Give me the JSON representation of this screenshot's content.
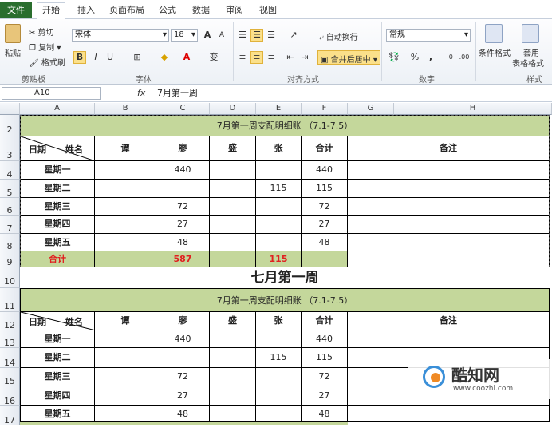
{
  "ribbon_tabs": {
    "file": "文件",
    "home": "开始",
    "insert": "插入",
    "layout": "页面布局",
    "formula": "公式",
    "data": "数据",
    "review": "审阅",
    "view": "视图"
  },
  "clipboard": {
    "paste": "粘贴",
    "cut": "剪切",
    "copy": "复制",
    "format_painter": "格式刷",
    "label": "剪贴板"
  },
  "font": {
    "name": "宋体",
    "size": "18",
    "label": "字体",
    "bold": "B",
    "italic": "I",
    "underline": "U",
    "grow": "A",
    "shrink": "A",
    "wen": "变"
  },
  "alignment": {
    "wrap": "自动换行",
    "merge": "合并后居中",
    "label": "对齐方式"
  },
  "number": {
    "format": "常规",
    "percent": "%",
    "comma": ",",
    "inc": ".0",
    "dec": ".00",
    "label": "数字"
  },
  "styles": {
    "conditional": "条件格式",
    "table1": "套用",
    "table2": "表格格式",
    "label": "样式"
  },
  "formula_bar": {
    "name_box": "A10",
    "fx": "fx",
    "content": "7月第一周"
  },
  "columns": [
    "A",
    "B",
    "C",
    "D",
    "E",
    "F",
    "G",
    "H"
  ],
  "rows": [
    "2",
    "3",
    "4",
    "5",
    "6",
    "7",
    "8",
    "9",
    "10",
    "11",
    "12",
    "13",
    "14",
    "15",
    "16",
    "17"
  ],
  "table1": {
    "title": "7月第一周支配明细账 （7.1-7.5）",
    "header": {
      "date": "日期",
      "name": "姓名",
      "tan": "谭",
      "liao": "廖",
      "sheng": "盛",
      "zhang": "张",
      "total": "合计",
      "note": "备注"
    },
    "body": [
      {
        "day": "星期一",
        "tan": "",
        "liao": "440",
        "sheng": "",
        "zhang": "",
        "total": "440"
      },
      {
        "day": "星期二",
        "tan": "",
        "liao": "",
        "sheng": "",
        "zhang": "115",
        "total": "115"
      },
      {
        "day": "星期三",
        "tan": "",
        "liao": "72",
        "sheng": "",
        "zhang": "",
        "total": "72"
      },
      {
        "day": "星期四",
        "tan": "",
        "liao": "27",
        "sheng": "",
        "zhang": "",
        "total": "27"
      },
      {
        "day": "星期五",
        "tan": "",
        "liao": "48",
        "sheng": "",
        "zhang": "",
        "total": "48"
      }
    ],
    "sum": {
      "label": "合计",
      "liao": "587",
      "zhang": "115"
    }
  },
  "heading10": "七月第一周",
  "table2": {
    "title": "7月第一周支配明细账 （7.1-7.5）",
    "header": {
      "date": "日期",
      "name": "姓名",
      "tan": "谭",
      "liao": "廖",
      "sheng": "盛",
      "zhang": "张",
      "total": "合计",
      "note": "备注"
    },
    "body": [
      {
        "day": "星期一",
        "liao": "440",
        "zhang": "",
        "total": "440"
      },
      {
        "day": "星期二",
        "liao": "",
        "zhang": "115",
        "total": "115"
      },
      {
        "day": "星期三",
        "liao": "72",
        "zhang": "",
        "total": "72"
      },
      {
        "day": "星期四",
        "liao": "27",
        "zhang": "",
        "total": "27"
      },
      {
        "day": "星期五",
        "liao": "48",
        "zhang": "",
        "total": "48"
      }
    ]
  },
  "watermark": {
    "brand": "酷知网",
    "url": "www.coozhi.com"
  }
}
